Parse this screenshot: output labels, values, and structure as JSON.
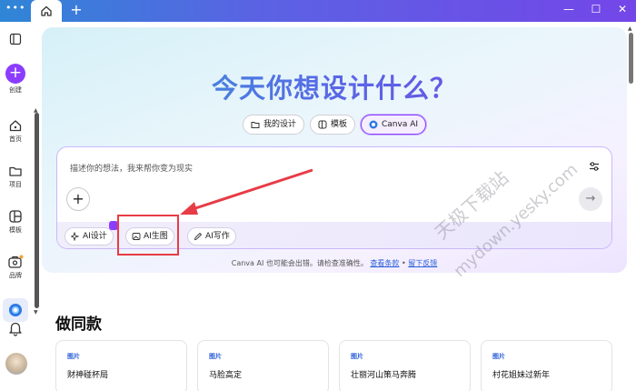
{
  "titlebar": {
    "menu_glyph": "•••",
    "home_icon": "home-icon",
    "new_tab_glyph": "+",
    "window_controls": {
      "minimize": "—",
      "maximize": "☐",
      "close": "✕"
    }
  },
  "sidebar": {
    "create_label": "创建",
    "items": [
      {
        "label": "首页",
        "icon": "home-icon"
      },
      {
        "label": "项目",
        "icon": "folder-icon"
      },
      {
        "label": "模板",
        "icon": "template-icon"
      },
      {
        "label": "品牌",
        "icon": "brand-icon"
      }
    ]
  },
  "hero": {
    "title": "今天你想设计什么？",
    "tabs": [
      {
        "label": "我的设计",
        "icon": "folder-icon"
      },
      {
        "label": "模板",
        "icon": "template-icon"
      },
      {
        "label": "Canva AI",
        "icon": "canva-ai-icon",
        "active": true
      }
    ],
    "prompt": {
      "placeholder": "描述你的想法，我来帮你变为现实"
    },
    "chips": [
      {
        "label": "AI设计",
        "icon": "sparkle-icon"
      },
      {
        "label": "AI生图",
        "icon": "image-icon",
        "highlighted": true
      },
      {
        "label": "AI写作",
        "icon": "pen-icon"
      }
    ],
    "disclaimer": {
      "text": "Canva AI 也可能会出错。请检查准确性。",
      "link1": "查看条款",
      "sep": "•",
      "link2": "留下反馈"
    }
  },
  "section": {
    "title": "做同款",
    "cards": [
      {
        "category": "图片",
        "title": "财神碰杯局"
      },
      {
        "category": "图片",
        "title": "马脸高定"
      },
      {
        "category": "图片",
        "title": "壮丽河山策马奔腾"
      },
      {
        "category": "图片",
        "title": "村花姐妹过新年"
      }
    ]
  },
  "watermark": {
    "line1": "天极下载站",
    "line2": "mydown.yesky.com"
  },
  "colors": {
    "accent": "#8b3dff",
    "annotation_red": "#e73c46",
    "link_blue": "#2b5fd9"
  }
}
